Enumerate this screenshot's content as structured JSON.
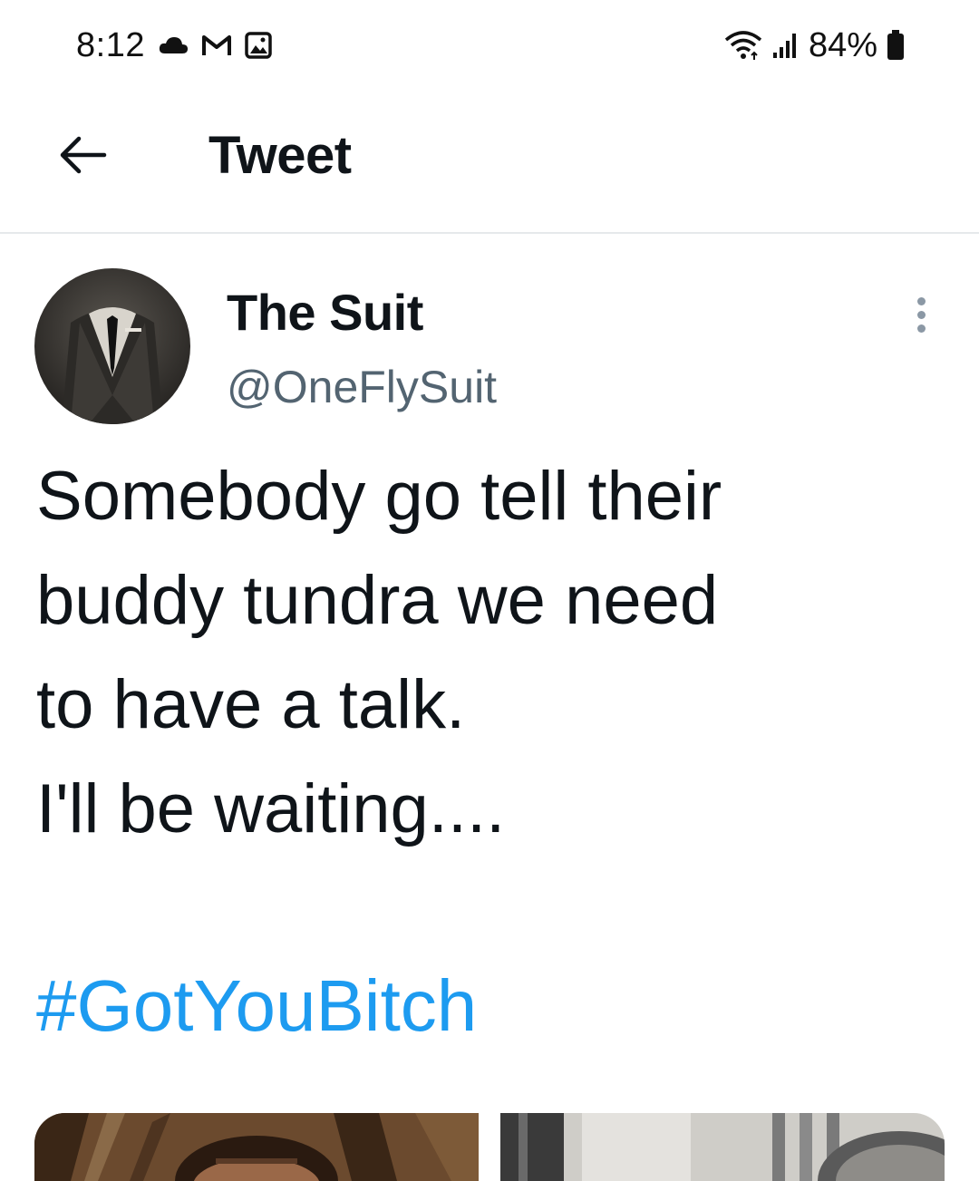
{
  "status_bar": {
    "time": "8:12",
    "left_icons": [
      "cloud-icon",
      "gmail-icon",
      "gallery-icon"
    ],
    "right_icons": [
      "wifi-icon",
      "signal-icon",
      "battery-icon"
    ],
    "battery": "84%"
  },
  "header": {
    "back_icon": "arrow-left-icon",
    "title": "Tweet"
  },
  "tweet": {
    "author_name": "The Suit",
    "author_handle": "@OneFlySuit",
    "text_lines": [
      "Somebody go tell their",
      "buddy tundra we need",
      "to have a talk.",
      "I'll be waiting...."
    ],
    "hashtag": "#GotYouBitch"
  },
  "colors": {
    "text": "#0f1419",
    "secondary": "#536471",
    "link": "#1d9bf0",
    "divider": "#e6e9eb"
  }
}
